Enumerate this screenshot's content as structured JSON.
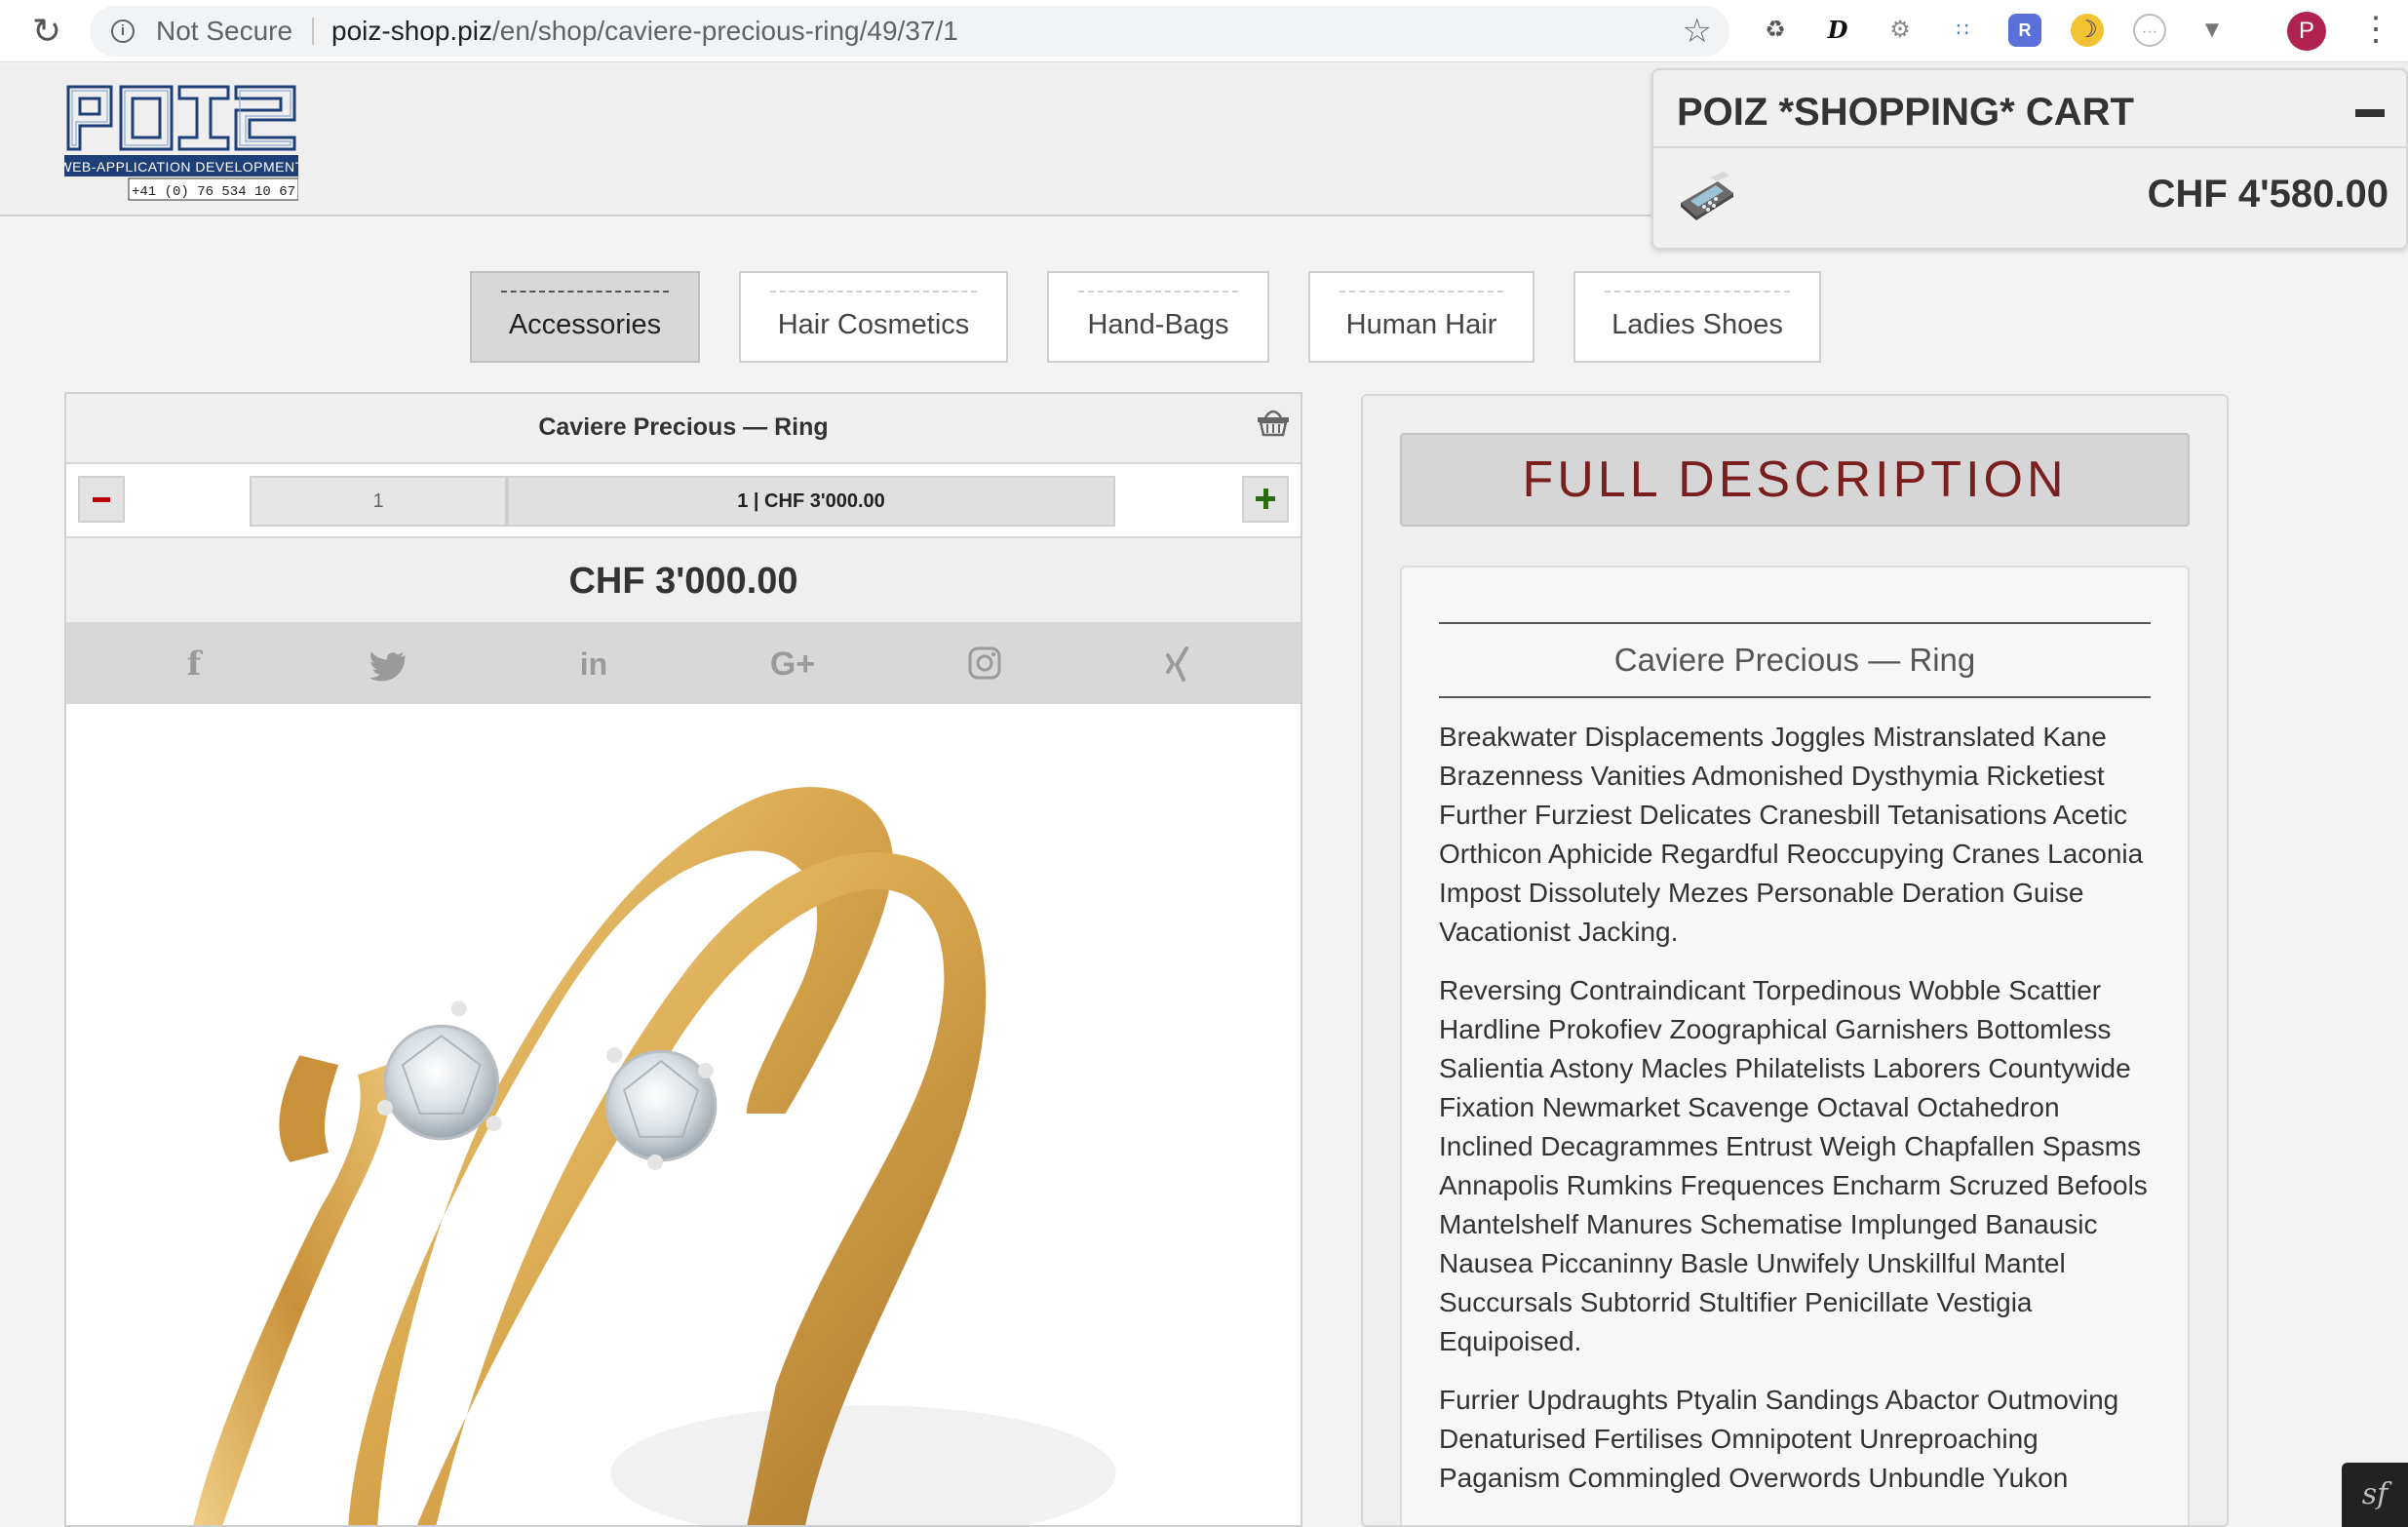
{
  "browser": {
    "security_label": "Not Secure",
    "url_host": "poiz-shop.piz",
    "url_path": "/en/shop/caviere-precious-ring/49/37/1",
    "profile_initial": "P"
  },
  "logo": {
    "wordmark": "POIZ",
    "tagline": "WEB-APPLICATION DEVELOPMENT",
    "phone": "+41 (0) 76 534 10 67"
  },
  "cart": {
    "title": "POIZ *SHOPPING* CART",
    "total": "CHF 4'580.00"
  },
  "tabs": [
    {
      "label": "Accessories",
      "active": true
    },
    {
      "label": "Hair Cosmetics",
      "active": false
    },
    {
      "label": "Hand-Bags",
      "active": false
    },
    {
      "label": "Human Hair",
      "active": false
    },
    {
      "label": "Ladies Shoes",
      "active": false
    }
  ],
  "product": {
    "title": "Caviere Precious — Ring",
    "quantity": "1",
    "summary": "1 | CHF 3'000.00",
    "price": "CHF 3'000.00",
    "social_icons": [
      "facebook-icon",
      "twitter-icon",
      "linkedin-icon",
      "google-plus-icon",
      "instagram-icon",
      "xing-icon"
    ]
  },
  "description": {
    "heading": "FULL DESCRIPTION",
    "title": "Caviere Precious — Ring",
    "paragraphs": [
      "Breakwater Displacements Joggles Mistranslated Kane Brazenness Vanities Admonished Dysthymia Ricketiest Further Furziest Delicates Cranesbill Tetanisations Acetic Orthicon Aphicide Regardful Reoccupying Cranes Laconia Impost Dissolutely Mezes Personable Deration Guise Vacationist Jacking.",
      "Reversing Contraindicant Torpedinous Wobble Scattier Hardline Prokofiev Zoographical Garnishers Bottomless Salientia Astony Macles Philatelists Laborers Countywide Fixation Newmarket Scavenge Octaval Octahedron Inclined Decagrammes Entrust Weigh Chapfallen Spasms Annapolis Rumkins Frequences Encharm Scruzed Befools Mantelshelf Manures Schematise Implunged Banausic Nausea Piccaninny Basle Unwifely Unskillful Mantel Succursals Subtorrid Stultifier Penicillate Vestigia Equipoised.",
      "Furrier Updraughts Ptyalin Sandings Abactor Outmoving Denaturised Fertilises Omnipotent Unreproaching Paganism Commingled Overwords Unbundle Yukon"
    ]
  },
  "colors": {
    "accent_heading": "#7a1f1f",
    "minus": "#bb0000",
    "plus": "#2a6a10",
    "logo_blue": "#1f3f78",
    "gold": "#d9a84e"
  }
}
